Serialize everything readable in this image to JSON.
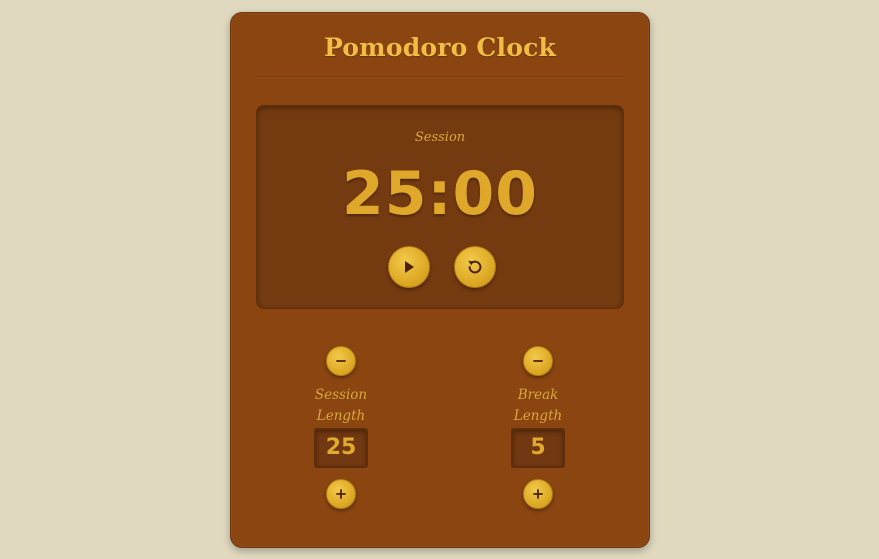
{
  "app": {
    "title": "Pomodoro Clock"
  },
  "timer": {
    "label": "Session",
    "time": "25:00",
    "play_icon": "play-icon",
    "reset_icon": "reset-icon"
  },
  "session": {
    "label_line1": "Session",
    "label_line2": "Length",
    "value": "25",
    "decrement_icon": "minus-icon",
    "increment_icon": "plus-icon"
  },
  "break": {
    "label_line1": "Break",
    "label_line2": "Length",
    "value": "5",
    "decrement_icon": "minus-icon",
    "increment_icon": "plus-icon"
  },
  "colors": {
    "page_background": "#e0d9c0",
    "card_background": "#8a4511",
    "display_background": "#743a10",
    "accent_gold": "#f2bd45",
    "button_gold": "#deaa25",
    "icon_dark": "#5a2a08"
  }
}
